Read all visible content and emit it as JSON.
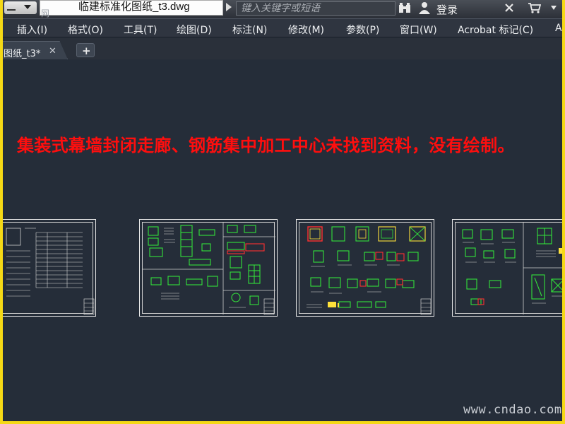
{
  "titlebar": {
    "watermark_text": "网",
    "document_title": "临建标准化图纸_t3.dwg",
    "search_placeholder": "键入关键字或短语",
    "login_label": "登录"
  },
  "menu": {
    "items": [
      "插入(I)",
      "格式(O)",
      "工具(T)",
      "绘图(D)",
      "标注(N)",
      "修改(M)",
      "参数(P)",
      "窗口(W)",
      "Acrobat 标记(C)",
      "A"
    ]
  },
  "tabs": {
    "active_label": "图纸_t3*",
    "close_glyph": "✕",
    "add_glyph": "+"
  },
  "canvas": {
    "notice_text": "集装式幕墙封闭走廊、钢筋集中加工中心未找到资料，没有绘制。",
    "watermark": "www.cndao.com"
  },
  "colors": {
    "frame": "#f5d916",
    "canvas_bg": "#252d39",
    "notice": "#ff0e0e",
    "cad_green": "#33e23a",
    "cad_red": "#ff3030",
    "cad_yellow": "#ffe23a"
  },
  "icons": [
    "binoculars-icon",
    "user-icon",
    "x-icon",
    "cart-icon",
    "help-icon",
    "close-icon",
    "plus-icon"
  ]
}
